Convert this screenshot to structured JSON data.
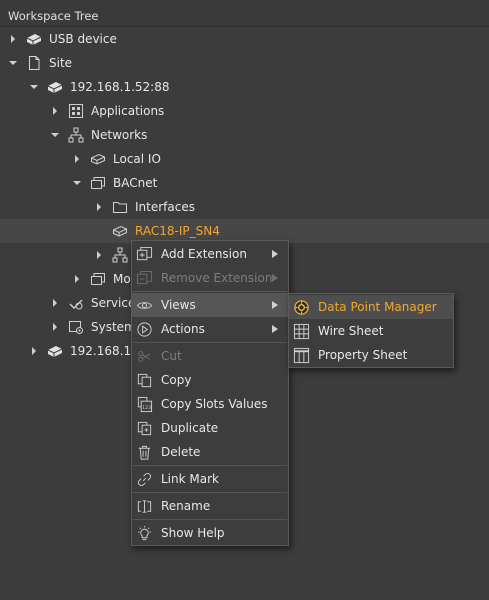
{
  "panel": {
    "title": "Workspace Tree"
  },
  "tree": {
    "usb": "USB device",
    "site": "Site",
    "ip1": "192.168.1.52:88",
    "applications": "Applications",
    "networks": "Networks",
    "local_io": "Local IO",
    "bacnet": "BACnet",
    "interfaces": "Interfaces",
    "rac": "RAC18-IP_SN4",
    "modbus_partial": "Mo",
    "services_partial": "Service",
    "system_partial": "System",
    "ip2_partial": "192.168.1."
  },
  "context_menu": {
    "add_extension": "Add Extension",
    "remove_extension": "Remove Extension",
    "views": "Views",
    "actions": "Actions",
    "cut": "Cut",
    "copy": "Copy",
    "copy_slots_values": "Copy Slots Values",
    "duplicate": "Duplicate",
    "delete": "Delete",
    "link_mark": "Link Mark",
    "rename": "Rename",
    "show_help": "Show Help"
  },
  "views_submenu": {
    "data_point_manager": "Data Point Manager",
    "wire_sheet": "Wire Sheet",
    "property_sheet": "Property Sheet"
  },
  "colors": {
    "accent": "#f0a830",
    "background": "#3c3c3c"
  }
}
